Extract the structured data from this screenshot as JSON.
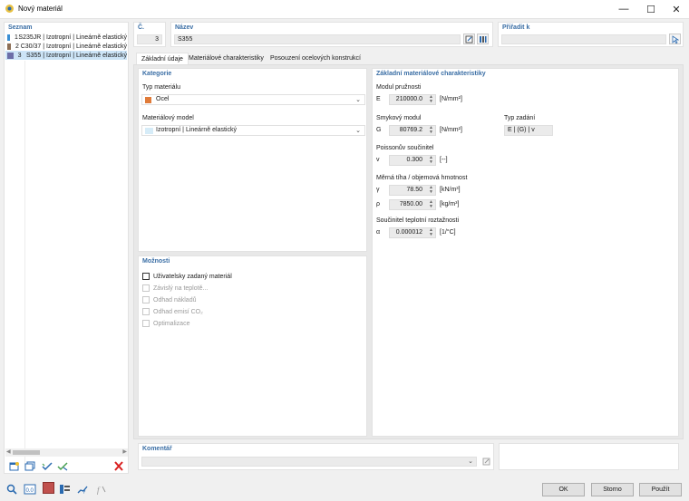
{
  "window": {
    "title": "Nový materiál"
  },
  "list": {
    "title": "Seznam",
    "items": [
      {
        "num": "1",
        "label": "S235JR | Izotropní | Lineárně elastický",
        "color": "#3a8fd4"
      },
      {
        "num": "2",
        "label": "C30/37 | Izotropní | Lineárně elastický",
        "color": "#8c6e55"
      },
      {
        "num": "3",
        "label": "S355 | Izotropní | Lineárně elastický",
        "color": "#6c6ea8",
        "selected": true
      }
    ]
  },
  "header": {
    "num_label": "Č.",
    "num_value": "3",
    "name_label": "Název",
    "name_value": "S355",
    "assign_label": "Přiřadit k"
  },
  "tabs": [
    "Základní údaje",
    "Materiálové charakteristiky",
    "Posouzení ocelových konstrukcí"
  ],
  "category": {
    "title": "Kategorie",
    "type_label": "Typ materiálu",
    "type_value": "Ocel",
    "type_color": "#e07b39",
    "model_label": "Materiálový model",
    "model_value": "Izotropní | Lineárně elastický"
  },
  "options": {
    "title": "Možnosti",
    "items": [
      {
        "label": "Uživatelsky zadaný materiál",
        "enabled": true
      },
      {
        "label": "Závislý na teplotě...",
        "enabled": false
      },
      {
        "label": "Odhad nákladů",
        "enabled": false
      },
      {
        "label": "Odhad emisí CO₂",
        "enabled": false
      },
      {
        "label": "Optimalizace",
        "enabled": false
      }
    ]
  },
  "props": {
    "title": "Základní materiálové charakteristiky",
    "elastic_title": "Modul pružnosti",
    "E_sym": "E",
    "E_val": "210000.0",
    "E_unit": "[N/mm²]",
    "shear_title": "Smykový modul",
    "G_sym": "G",
    "G_val": "80769.2",
    "G_unit": "[N/mm²]",
    "input_type_title": "Typ zadání",
    "input_type_val": "E | (G) | v",
    "poisson_title": "Poissonův součinitel",
    "v_sym": "v",
    "v_val": "0.300",
    "v_unit": "[--]",
    "weight_title": "Měrná tíha / objemová hmotnost",
    "gamma_sym": "γ",
    "gamma_val": "78.50",
    "gamma_unit": "[kN/m³]",
    "rho_sym": "ρ",
    "rho_val": "7850.00",
    "rho_unit": "[kg/m³]",
    "thermal_title": "Součinitel teplotní roztažnosti",
    "alpha_sym": "α",
    "alpha_val": "0.000012",
    "alpha_unit": "[1/°C]"
  },
  "comment": {
    "title": "Komentář"
  },
  "buttons": {
    "ok": "OK",
    "cancel": "Storno",
    "apply": "Použít"
  }
}
